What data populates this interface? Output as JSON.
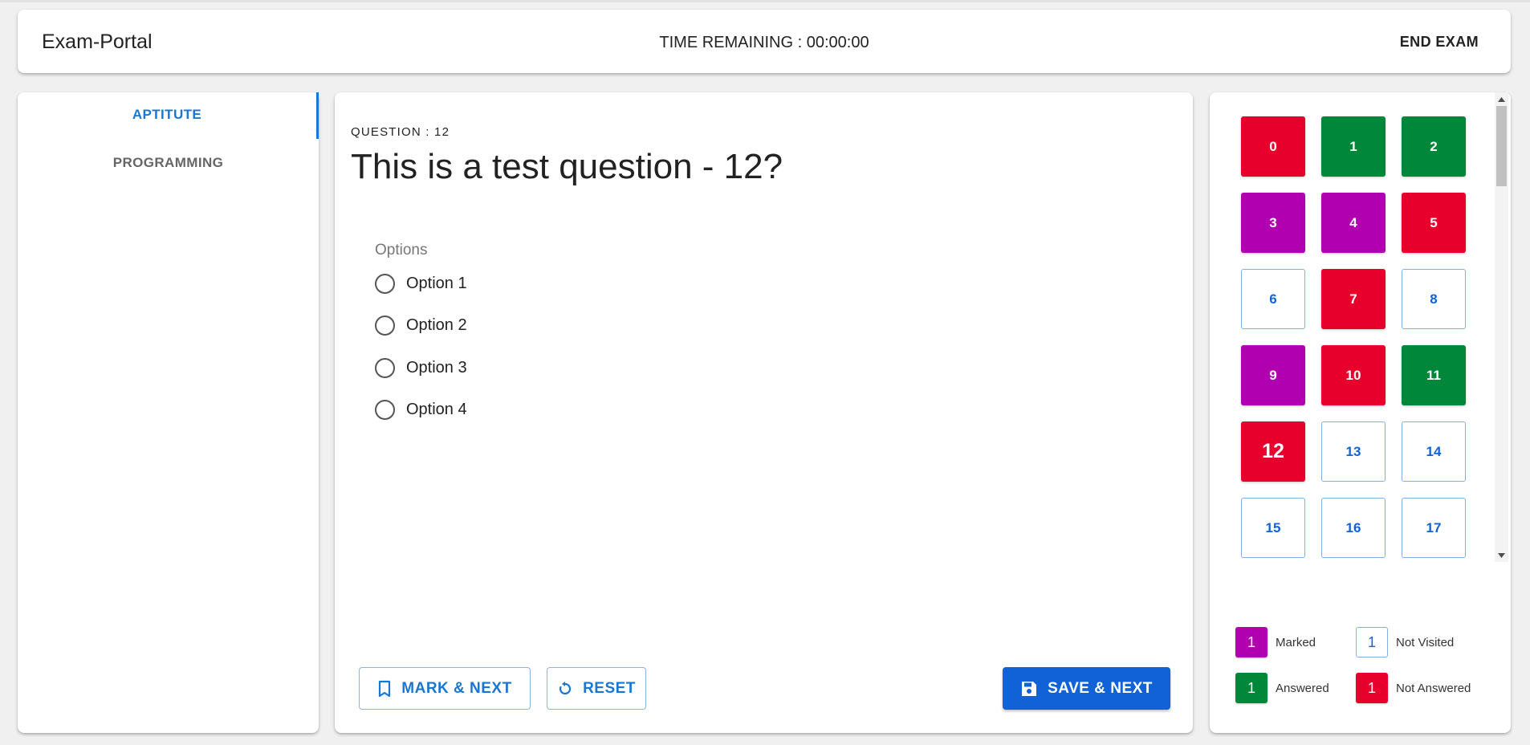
{
  "header": {
    "brand": "Exam-Portal",
    "timer_text": "TIME REMAINING : 00:00:00",
    "end_exam_label": "END EXAM"
  },
  "sections": {
    "tabs": [
      {
        "label": "APTITUTE",
        "active": true
      },
      {
        "label": "PROGRAMMING",
        "active": false
      }
    ]
  },
  "question": {
    "number_label": "QUESTION : 12",
    "title": "This is a test question - 12?",
    "options_legend": "Options",
    "options": [
      "Option 1",
      "Option 2",
      "Option 3",
      "Option 4"
    ]
  },
  "actions": {
    "mark_next_label": "MARK & NEXT",
    "reset_label": "RESET",
    "save_next_label": "SAVE & NEXT"
  },
  "palette": {
    "current": "12",
    "questions": [
      {
        "label": "0",
        "status": "not-answered"
      },
      {
        "label": "1",
        "status": "answered"
      },
      {
        "label": "2",
        "status": "answered"
      },
      {
        "label": "3",
        "status": "marked"
      },
      {
        "label": "4",
        "status": "marked"
      },
      {
        "label": "5",
        "status": "not-answered"
      },
      {
        "label": "6",
        "status": "not-visited"
      },
      {
        "label": "7",
        "status": "not-answered"
      },
      {
        "label": "8",
        "status": "not-visited"
      },
      {
        "label": "9",
        "status": "marked"
      },
      {
        "label": "10",
        "status": "not-answered"
      },
      {
        "label": "11",
        "status": "answered"
      },
      {
        "label": "12",
        "status": "not-answered"
      },
      {
        "label": "13",
        "status": "not-visited"
      },
      {
        "label": "14",
        "status": "not-visited"
      },
      {
        "label": "15",
        "status": "not-visited"
      },
      {
        "label": "16",
        "status": "not-visited"
      },
      {
        "label": "17",
        "status": "not-visited"
      }
    ],
    "legend": [
      {
        "count": "1",
        "label": "Marked",
        "status": "marked"
      },
      {
        "count": "1",
        "label": "Not Visited",
        "status": "not-visited"
      },
      {
        "count": "1",
        "label": "Answered",
        "status": "answered"
      },
      {
        "count": "1",
        "label": "Not Answered",
        "status": "not-answered"
      }
    ]
  },
  "colors": {
    "accent": "#1976d2",
    "save_button": "#1062d6",
    "marked": "#b000b0",
    "answered": "#00873a",
    "not_answered": "#e8002d",
    "not_visited_border": "#7fb0ec"
  },
  "icons": {
    "mark": "bookmark-icon",
    "reset": "refresh-icon",
    "save": "floppy-disk-icon"
  }
}
